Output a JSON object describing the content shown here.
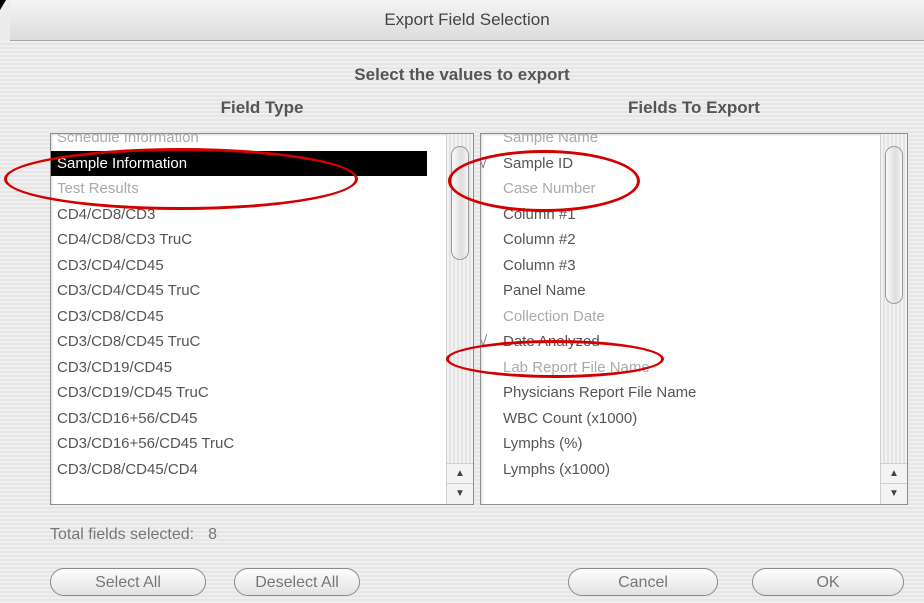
{
  "window": {
    "title": "Export Field Selection"
  },
  "instruction": "Select the values to export",
  "field_type": {
    "heading": "Field Type",
    "items": [
      {
        "label": "Schedule Information",
        "state": "dim"
      },
      {
        "label": "Sample Information",
        "state": "selected"
      },
      {
        "label": "Test Results",
        "state": "dim"
      },
      {
        "label": "CD4/CD8/CD3",
        "state": "normal"
      },
      {
        "label": "CD4/CD8/CD3 TruC",
        "state": "normal"
      },
      {
        "label": "CD3/CD4/CD45",
        "state": "normal"
      },
      {
        "label": "CD3/CD4/CD45 TruC",
        "state": "normal"
      },
      {
        "label": "CD3/CD8/CD45",
        "state": "normal"
      },
      {
        "label": "CD3/CD8/CD45 TruC",
        "state": "normal"
      },
      {
        "label": "CD3/CD19/CD45",
        "state": "normal"
      },
      {
        "label": "CD3/CD19/CD45 TruC",
        "state": "normal"
      },
      {
        "label": "CD3/CD16+56/CD45",
        "state": "normal"
      },
      {
        "label": "CD3/CD16+56/CD45 TruC",
        "state": "normal"
      },
      {
        "label": "CD3/CD8/CD45/CD4",
        "state": "normal"
      }
    ]
  },
  "fields_to_export": {
    "heading": "Fields To Export",
    "items": [
      {
        "label": "Sample Name",
        "checked": false,
        "state": "dim"
      },
      {
        "label": "Sample ID",
        "checked": true,
        "state": "normal"
      },
      {
        "label": "Case Number",
        "checked": false,
        "state": "dim"
      },
      {
        "label": "Column #1",
        "checked": false,
        "state": "normal"
      },
      {
        "label": "Column #2",
        "checked": false,
        "state": "normal"
      },
      {
        "label": "Column #3",
        "checked": false,
        "state": "normal"
      },
      {
        "label": "Panel Name",
        "checked": false,
        "state": "normal"
      },
      {
        "label": "Collection Date",
        "checked": false,
        "state": "dim"
      },
      {
        "label": "Date Analyzed",
        "checked": true,
        "state": "normal"
      },
      {
        "label": "Lab Report File Name",
        "checked": false,
        "state": "dim"
      },
      {
        "label": "Physicians Report File Name",
        "checked": false,
        "state": "normal"
      },
      {
        "label": "WBC Count (x1000)",
        "checked": false,
        "state": "normal"
      },
      {
        "label": "Lymphs (%)",
        "checked": false,
        "state": "normal"
      },
      {
        "label": "Lymphs (x1000)",
        "checked": false,
        "state": "normal"
      }
    ]
  },
  "check_mark": "√",
  "status": {
    "label": "Total fields selected:",
    "count": "8"
  },
  "buttons": {
    "select_all": "Select All",
    "deselect_all": "Deselect All",
    "cancel": "Cancel",
    "ok": "OK"
  },
  "annotation_color": "#d40000"
}
